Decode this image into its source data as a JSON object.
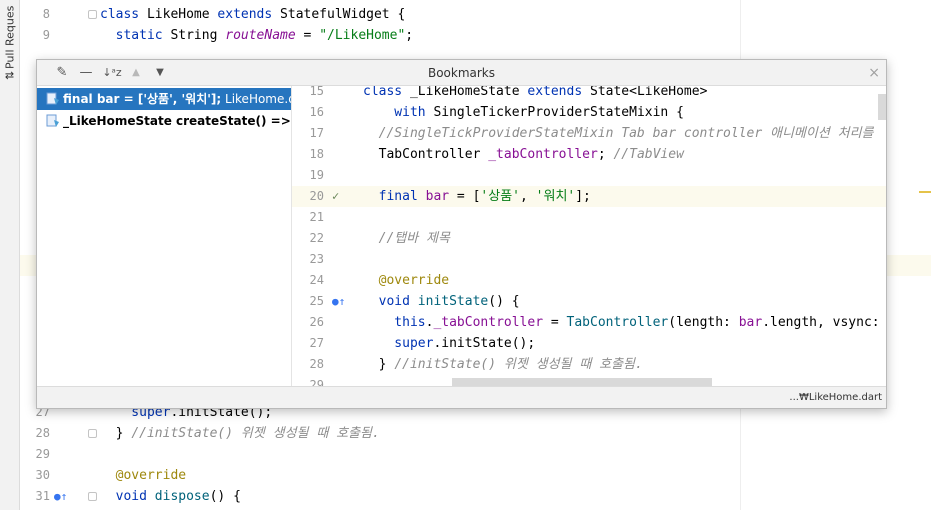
{
  "tool_strip": {
    "tab_label": "Pull Reques"
  },
  "editor": {
    "lines_top": [
      {
        "num": "8",
        "tokens": [
          {
            "t": "class ",
            "c": "kw"
          },
          {
            "t": "LikeHome ",
            "c": "cls"
          },
          {
            "t": "extends ",
            "c": "kw"
          },
          {
            "t": "StatefulWidget {",
            "c": "cls"
          }
        ]
      },
      {
        "num": "9",
        "tokens": [
          {
            "t": "  static ",
            "c": "kw"
          },
          {
            "t": "String ",
            "c": "cls"
          },
          {
            "t": "routeName",
            "c": "fld ital"
          },
          {
            "t": " = ",
            "c": "cls"
          },
          {
            "t": "\"/LikeHome\"",
            "c": "str"
          },
          {
            "t": ";",
            "c": "cls"
          }
        ]
      }
    ],
    "lines_bottom": [
      {
        "num": "27",
        "tokens": [
          {
            "t": "    super",
            "c": "kw"
          },
          {
            "t": ".initState();",
            "c": "cls"
          }
        ]
      },
      {
        "num": "28",
        "tokens": [
          {
            "t": "  } ",
            "c": "cls"
          },
          {
            "t": "//initState() 위젯 생성될 때 호출됨.",
            "c": "cmt"
          }
        ]
      },
      {
        "num": "29",
        "tokens": []
      },
      {
        "num": "30",
        "tokens": [
          {
            "t": "  @override",
            "c": "ann"
          }
        ]
      },
      {
        "num": "31",
        "mark": "●↑",
        "tokens": [
          {
            "t": "  void ",
            "c": "kw"
          },
          {
            "t": "dispose",
            "c": "fn"
          },
          {
            "t": "() {",
            "c": "cls"
          }
        ]
      }
    ]
  },
  "popup": {
    "title": "Bookmarks",
    "close_glyph": "×",
    "toolbar": {
      "edit_glyph": "✎",
      "remove_glyph": "—",
      "sort_glyph": "↓ᵃz",
      "up_glyph": "▲",
      "down_glyph": "▼"
    },
    "bookmarks": [
      {
        "label": "final bar = ['상품', '워치'];",
        "file": " LikeHome.dart",
        "selected": true
      },
      {
        "label": "_LikeHomeState createState() => _LikeHomeState();",
        "file": "",
        "selected": false
      }
    ],
    "footer_path": "...₩LikeHome.dart",
    "preview_lines": [
      {
        "num": "15",
        "mark": "",
        "tokens": [
          {
            "t": "class ",
            "c": "kw"
          },
          {
            "t": "_LikeHomeState ",
            "c": "cls"
          },
          {
            "t": "extends ",
            "c": "kw"
          },
          {
            "t": "State<LikeHome>",
            "c": "cls"
          }
        ]
      },
      {
        "num": "16",
        "mark": "",
        "tokens": [
          {
            "t": "    with ",
            "c": "kw"
          },
          {
            "t": "SingleTickerProviderStateMixin {",
            "c": "cls"
          }
        ]
      },
      {
        "num": "17",
        "mark": "",
        "tokens": [
          {
            "t": "  //SingleTickProviderStateMixin Tab bar controller 애니메이션 처리를",
            "c": "cmt"
          }
        ]
      },
      {
        "num": "18",
        "mark": "",
        "tokens": [
          {
            "t": "  TabController ",
            "c": "cls"
          },
          {
            "t": "_tabController",
            "c": "fld"
          },
          {
            "t": "; ",
            "c": "cls"
          },
          {
            "t": "//TabView",
            "c": "cmt"
          }
        ]
      },
      {
        "num": "19",
        "mark": "",
        "tokens": []
      },
      {
        "num": "20",
        "mark": "✓",
        "hl": true,
        "tokens": [
          {
            "t": "  final ",
            "c": "kw"
          },
          {
            "t": "bar",
            "c": "fld"
          },
          {
            "t": " = [",
            "c": "cls"
          },
          {
            "t": "'상품'",
            "c": "str"
          },
          {
            "t": ", ",
            "c": "cls"
          },
          {
            "t": "'워치'",
            "c": "str"
          },
          {
            "t": "];",
            "c": "cls"
          }
        ]
      },
      {
        "num": "21",
        "mark": "",
        "tokens": []
      },
      {
        "num": "22",
        "mark": "",
        "tokens": [
          {
            "t": "  //탭바 제목",
            "c": "cmt"
          }
        ]
      },
      {
        "num": "23",
        "mark": "",
        "tokens": []
      },
      {
        "num": "24",
        "mark": "",
        "tokens": [
          {
            "t": "  @override",
            "c": "ann"
          }
        ]
      },
      {
        "num": "25",
        "mark": "●↑",
        "tokens": [
          {
            "t": "  void ",
            "c": "kw"
          },
          {
            "t": "initState",
            "c": "fn"
          },
          {
            "t": "() {",
            "c": "cls"
          }
        ]
      },
      {
        "num": "26",
        "mark": "",
        "tokens": [
          {
            "t": "    this",
            "c": "kw"
          },
          {
            "t": ".",
            "c": "cls"
          },
          {
            "t": "_tabController",
            "c": "fld"
          },
          {
            "t": " = ",
            "c": "cls"
          },
          {
            "t": "TabController",
            "c": "fn"
          },
          {
            "t": "(length: ",
            "c": "cls"
          },
          {
            "t": "bar",
            "c": "fld"
          },
          {
            "t": ".length, vsync:",
            "c": "cls"
          }
        ]
      },
      {
        "num": "27",
        "mark": "",
        "tokens": [
          {
            "t": "    super",
            "c": "kw"
          },
          {
            "t": ".initState();",
            "c": "cls"
          }
        ]
      },
      {
        "num": "28",
        "mark": "",
        "tokens": [
          {
            "t": "  } ",
            "c": "cls"
          },
          {
            "t": "//initState() 위젯 생성될 때 호출됨.",
            "c": "cmt"
          }
        ]
      },
      {
        "num": "29",
        "mark": "",
        "tokens": []
      }
    ]
  },
  "colors": {
    "keyword": "#0033b3",
    "string": "#067d17",
    "field": "#871094",
    "comment": "#8c8c8c",
    "annotation": "#9e880d",
    "selection": "#2675bf",
    "current_line": "#fcfaed"
  }
}
